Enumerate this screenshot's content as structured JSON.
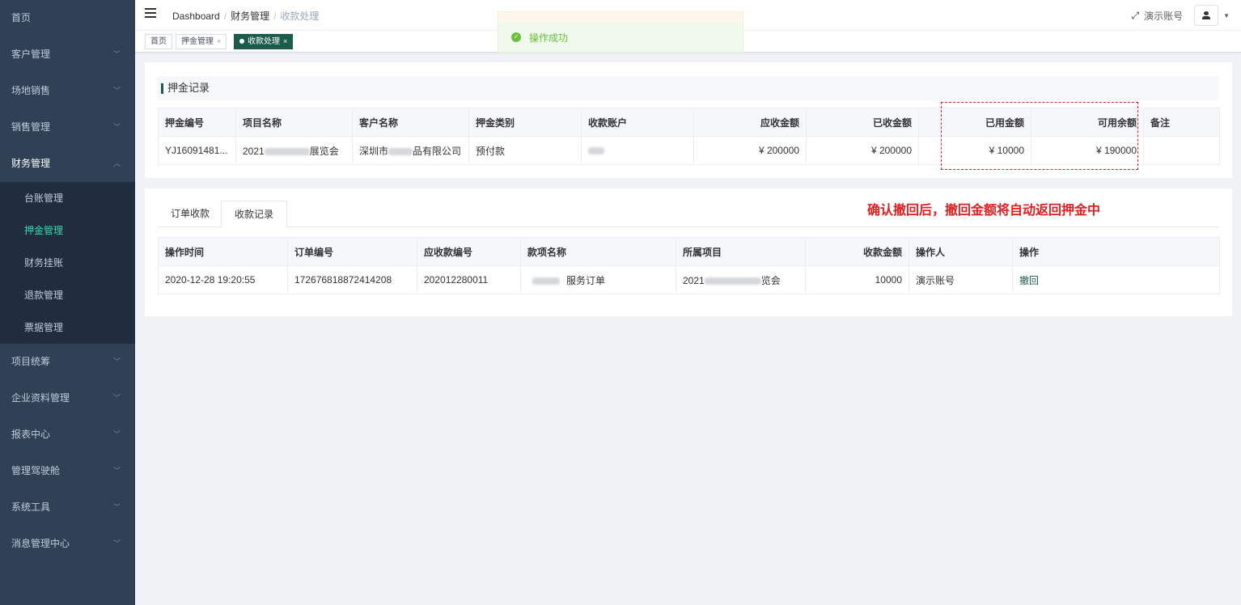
{
  "sidebar": {
    "items": [
      {
        "label": "首页",
        "has_children": false
      },
      {
        "label": "客户管理",
        "has_children": true
      },
      {
        "label": "场地销售",
        "has_children": true
      },
      {
        "label": "销售管理",
        "has_children": true
      },
      {
        "label": "财务管理",
        "has_children": true,
        "expanded": true
      },
      {
        "label": "项目统筹",
        "has_children": true
      },
      {
        "label": "企业资料管理",
        "has_children": true
      },
      {
        "label": "报表中心",
        "has_children": true
      },
      {
        "label": "管理驾驶舱",
        "has_children": true
      },
      {
        "label": "系统工具",
        "has_children": true
      },
      {
        "label": "消息管理中心",
        "has_children": true
      }
    ],
    "finance_sub": [
      {
        "label": "台账管理"
      },
      {
        "label": "押金管理",
        "active": true
      },
      {
        "label": "财务挂账"
      },
      {
        "label": "退款管理"
      },
      {
        "label": "票据管理"
      }
    ]
  },
  "header": {
    "breadcrumb": [
      "Dashboard",
      "财务管理",
      "收款处理"
    ],
    "username": "演示账号"
  },
  "tags": [
    {
      "label": "首页"
    },
    {
      "label": "押金管理"
    },
    {
      "label": "收款处理",
      "active": true
    }
  ],
  "toast": {
    "message": "操作成功"
  },
  "deposit": {
    "title": "押金记录",
    "columns": [
      "押金编号",
      "项目名称",
      "客户名称",
      "押金类别",
      "收款账户",
      "应收金额",
      "已收金额",
      "已用金额",
      "可用余额",
      "备注"
    ],
    "row": {
      "id": "YJ16091481...",
      "project_prefix": "2021",
      "project_suffix": "展览会",
      "customer_prefix": "深圳市",
      "customer_suffix": "品有限公司",
      "category": "预付款",
      "account": "",
      "receivable": "¥ 200000",
      "received": "¥ 200000",
      "used": "¥ 10000",
      "available": "¥ 190000",
      "remark": ""
    }
  },
  "records": {
    "tabs": [
      "订单收款",
      "收款记录"
    ],
    "active_tab": 1,
    "columns": [
      "操作时间",
      "订单编号",
      "应收款编号",
      "款项名称",
      "所属项目",
      "收款金额",
      "操作人",
      "操作"
    ],
    "row": {
      "time": "2020-12-28 19:20:55",
      "order_no": "172676818872414208",
      "receivable_no": "202012280011",
      "item_suffix": "服务订单",
      "project_prefix": "2021",
      "project_suffix": "览会",
      "amount": "10000",
      "operator": "演示账号",
      "action": "撤回"
    }
  },
  "annotation": "确认撤回后，撤回金额将自动返回押金中",
  "colors": {
    "sidebar": "#304156",
    "submenu": "#1f2d3d",
    "accent": "#1a5b4c",
    "active_menu": "#42d6b5",
    "annotation": "#e02020",
    "success": "#67c23a"
  }
}
